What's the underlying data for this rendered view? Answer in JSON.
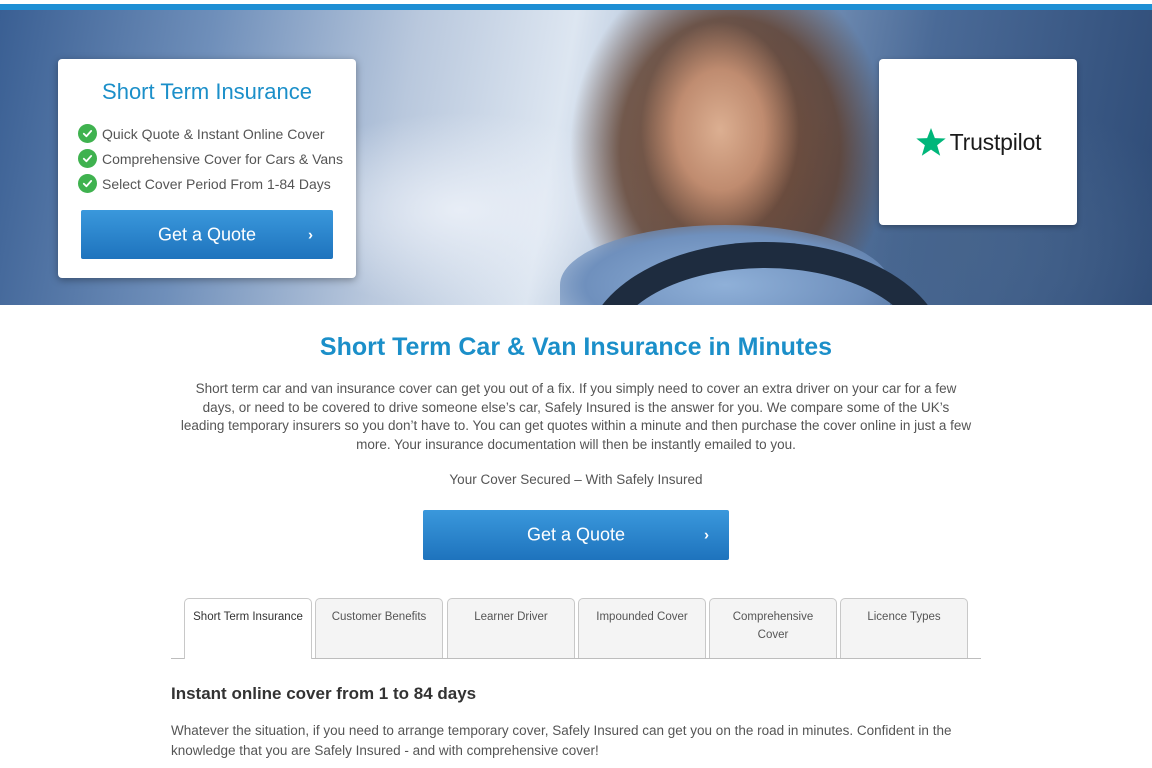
{
  "hero": {
    "promo_card": {
      "title": "Short Term Insurance",
      "features": [
        "Quick Quote & Instant Online Cover",
        "Comprehensive Cover for Cars & Vans",
        "Select Cover Period From 1-84 Days"
      ],
      "cta_label": "Get a Quote",
      "cta_icon": "›"
    },
    "trust_card": {
      "brand": "Trustpilot",
      "star_color": "#00b67a"
    }
  },
  "main": {
    "heading": "Short Term Car & Van Insurance in Minutes",
    "intro": "Short term car and van insurance cover can get you out of a fix. If you simply need to cover an extra driver on your car for a few days, or need to be covered to drive someone else’s car, Safely Insured is the answer for you. We compare some of the UK’s leading temporary insurers so you don’t have to. You can get quotes within a minute and then purchase the cover online in just a few more. Your insurance documentation will then be instantly emailed to you.",
    "tagline": "Your Cover Secured – With Safely Insured",
    "cta_label": "Get a Quote",
    "cta_icon": "›"
  },
  "tabs": [
    {
      "label": "Short Term Insurance",
      "active": true
    },
    {
      "label": "Customer Benefits",
      "active": false
    },
    {
      "label": "Learner Driver",
      "active": false
    },
    {
      "label": "Impounded Cover",
      "active": false
    },
    {
      "label": "Comprehensive Cover",
      "active": false
    },
    {
      "label": "Licence Types",
      "active": false
    }
  ],
  "tab_content": {
    "heading": "Instant online cover from 1 to 84 days",
    "body": "Whatever the situation, if you need to arrange temporary cover, Safely Insured can get you on the road in minutes. Confident in the knowledge that you are Safely Insured - and with comprehensive cover!"
  },
  "colors": {
    "accent": "#1b8fc9",
    "button": "#1e73bd",
    "check": "#3fb24f"
  }
}
